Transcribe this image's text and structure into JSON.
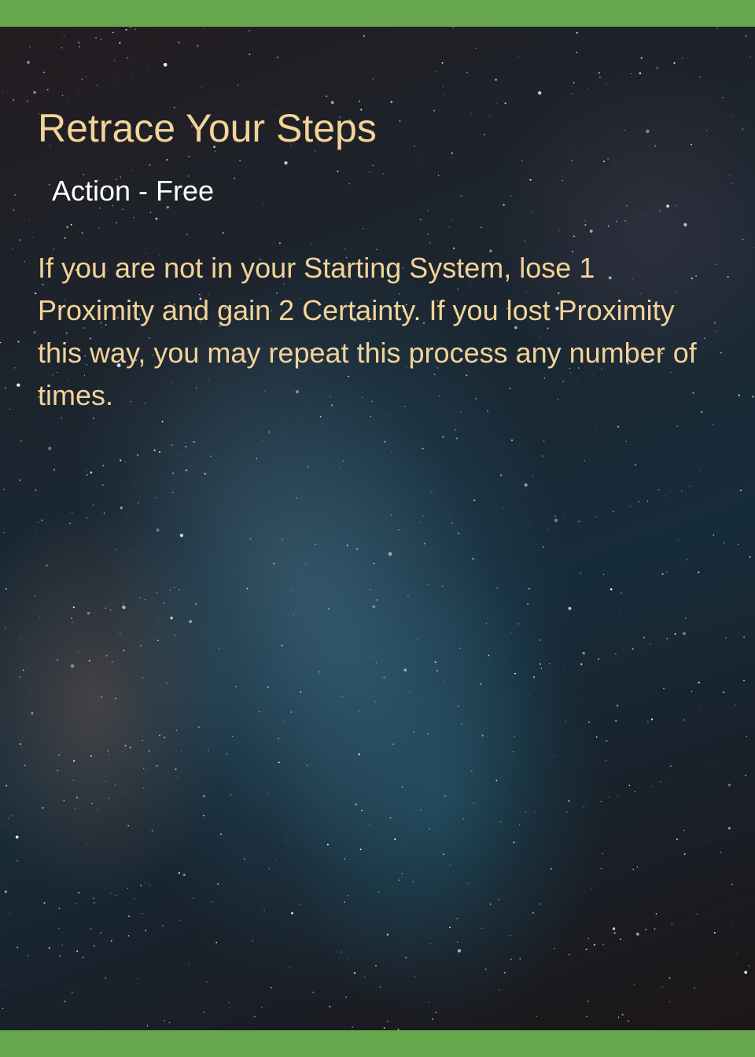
{
  "card": {
    "title": "Retrace Your Steps",
    "type_line": "Action - Free",
    "rules_text": "If you are not in your Starting System, lose 1 Proximity and gain 2 Certainty. If you lost Proximity this way, you may repeat this process any number of times."
  },
  "colors": {
    "frame_green": "#66a74d",
    "title_gold": "#f3d398",
    "type_white": "#ffffff"
  },
  "background": {
    "image": "starry-night-sky"
  }
}
